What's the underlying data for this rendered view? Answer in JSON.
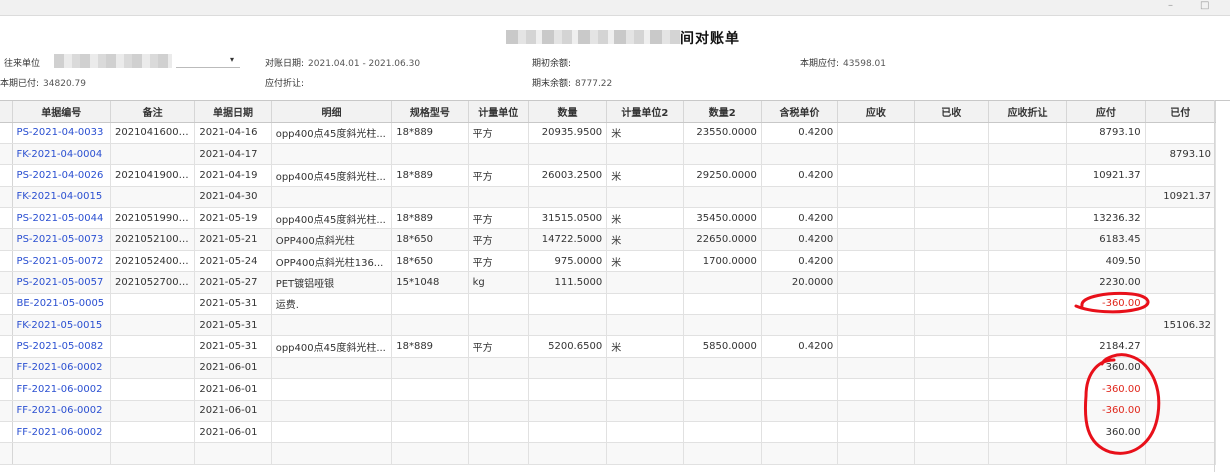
{
  "window": {
    "minimize": "–",
    "restore": "□"
  },
  "title": {
    "suffix": "间对账单"
  },
  "header": {
    "partner_label": "往来单位",
    "partner_value": "",
    "period_label": "对账日期:",
    "period_value": "2021.04.01 - 2021.06.30",
    "opening_label": "期初余额:",
    "opening_value": "",
    "payable_label": "本期应付:",
    "payable_value": "43598.01",
    "paid_label": "本期已付:",
    "paid_value": "34820.79",
    "discount_label": "应付折让:",
    "discount_value": "",
    "closing_label": "期末余额:",
    "closing_value": "8777.22"
  },
  "table": {
    "columns": [
      "单据编号",
      "备注",
      "单据日期",
      "明细",
      "规格型号",
      "计量单位",
      "数量",
      "计量单位2",
      "数量2",
      "含税单价",
      "应收",
      "已收",
      "应收折让",
      "应付",
      "已付"
    ],
    "rows": [
      {
        "no": "PS-2021-04-0033",
        "note": "20210416000...",
        "date": "2021-04-16",
        "detail": "opp400点45度斜光柱...",
        "spec": "18*889",
        "unit": "平方",
        "qty": "20935.9500",
        "unit2": "米",
        "qty2": "23550.0000",
        "price": "0.4200",
        "ar": "",
        "received": "",
        "ar_discount": "",
        "payable": "8793.10",
        "paid": ""
      },
      {
        "no": "FK-2021-04-0004",
        "note": "",
        "date": "2021-04-17",
        "detail": "",
        "spec": "",
        "unit": "",
        "qty": "",
        "unit2": "",
        "qty2": "",
        "price": "",
        "ar": "",
        "received": "",
        "ar_discount": "",
        "payable": "",
        "paid": "8793.10"
      },
      {
        "no": "PS-2021-04-0026",
        "note": "20210419000...",
        "date": "2021-04-19",
        "detail": "opp400点45度斜光柱...",
        "spec": "18*889",
        "unit": "平方",
        "qty": "26003.2500",
        "unit2": "米",
        "qty2": "29250.0000",
        "price": "0.4200",
        "ar": "",
        "received": "",
        "ar_discount": "",
        "payable": "10921.37",
        "paid": ""
      },
      {
        "no": "FK-2021-04-0015",
        "note": "",
        "date": "2021-04-30",
        "detail": "",
        "spec": "",
        "unit": "",
        "qty": "",
        "unit2": "",
        "qty2": "",
        "price": "",
        "ar": "",
        "received": "",
        "ar_discount": "",
        "payable": "",
        "paid": "10921.37"
      },
      {
        "no": "PS-2021-05-0044",
        "note": "20210519900...",
        "date": "2021-05-19",
        "detail": "opp400点45度斜光柱...",
        "spec": "18*889",
        "unit": "平方",
        "qty": "31515.0500",
        "unit2": "米",
        "qty2": "35450.0000",
        "price": "0.4200",
        "ar": "",
        "received": "",
        "ar_discount": "",
        "payable": "13236.32",
        "paid": ""
      },
      {
        "no": "PS-2021-05-0073",
        "note": "20210521000...",
        "date": "2021-05-21",
        "detail": "OPP400点斜光柱",
        "spec": "18*650",
        "unit": "平方",
        "qty": "14722.5000",
        "unit2": "米",
        "qty2": "22650.0000",
        "price": "0.4200",
        "ar": "",
        "received": "",
        "ar_discount": "",
        "payable": "6183.45",
        "paid": ""
      },
      {
        "no": "PS-2021-05-0072",
        "note": "20210524000...",
        "date": "2021-05-24",
        "detail": "OPP400点斜光柱136...",
        "spec": "18*650",
        "unit": "平方",
        "qty": "975.0000",
        "unit2": "米",
        "qty2": "1700.0000",
        "price": "0.4200",
        "ar": "",
        "received": "",
        "ar_discount": "",
        "payable": "409.50",
        "paid": ""
      },
      {
        "no": "PS-2021-05-0057",
        "note": "20210527000...",
        "date": "2021-05-27",
        "detail": "PET镀铝哑银",
        "spec": "15*1048",
        "unit": "kg",
        "qty": "111.5000",
        "unit2": "",
        "qty2": "",
        "price": "20.0000",
        "ar": "",
        "received": "",
        "ar_discount": "",
        "payable": "2230.00",
        "paid": ""
      },
      {
        "no": "BE-2021-05-0005",
        "note": "",
        "date": "2021-05-31",
        "detail": "运费.",
        "spec": "",
        "unit": "",
        "qty": "",
        "unit2": "",
        "qty2": "",
        "price": "",
        "ar": "",
        "received": "",
        "ar_discount": "",
        "payable": "-360.00",
        "paid": ""
      },
      {
        "no": "FK-2021-05-0015",
        "note": "",
        "date": "2021-05-31",
        "detail": "",
        "spec": "",
        "unit": "",
        "qty": "",
        "unit2": "",
        "qty2": "",
        "price": "",
        "ar": "",
        "received": "",
        "ar_discount": "",
        "payable": "",
        "paid": "15106.32"
      },
      {
        "no": "PS-2021-05-0082",
        "note": "",
        "date": "2021-05-31",
        "detail": "opp400点45度斜光柱...",
        "spec": "18*889",
        "unit": "平方",
        "qty": "5200.6500",
        "unit2": "米",
        "qty2": "5850.0000",
        "price": "0.4200",
        "ar": "",
        "received": "",
        "ar_discount": "",
        "payable": "2184.27",
        "paid": ""
      },
      {
        "no": "FF-2021-06-0002",
        "note": "",
        "date": "2021-06-01",
        "detail": "",
        "spec": "",
        "unit": "",
        "qty": "",
        "unit2": "",
        "qty2": "",
        "price": "",
        "ar": "",
        "received": "",
        "ar_discount": "",
        "payable": "360.00",
        "paid": ""
      },
      {
        "no": "FF-2021-06-0002",
        "note": "",
        "date": "2021-06-01",
        "detail": "",
        "spec": "",
        "unit": "",
        "qty": "",
        "unit2": "",
        "qty2": "",
        "price": "",
        "ar": "",
        "received": "",
        "ar_discount": "",
        "payable": "-360.00",
        "paid": ""
      },
      {
        "no": "FF-2021-06-0002",
        "note": "",
        "date": "2021-06-01",
        "detail": "",
        "spec": "",
        "unit": "",
        "qty": "",
        "unit2": "",
        "qty2": "",
        "price": "",
        "ar": "",
        "received": "",
        "ar_discount": "",
        "payable": "-360.00",
        "paid": ""
      },
      {
        "no": "FF-2021-06-0002",
        "note": "",
        "date": "2021-06-01",
        "detail": "",
        "spec": "",
        "unit": "",
        "qty": "",
        "unit2": "",
        "qty2": "",
        "price": "",
        "ar": "",
        "received": "",
        "ar_discount": "",
        "payable": "360.00",
        "paid": ""
      },
      {
        "no": "",
        "note": "",
        "date": "",
        "detail": "",
        "spec": "",
        "unit": "",
        "qty": "",
        "unit2": "",
        "qty2": "",
        "price": "",
        "ar": "",
        "received": "",
        "ar_discount": "",
        "payable": "",
        "paid": ""
      }
    ]
  },
  "colors": {
    "link": "#2a4fd1",
    "negative": "#e0261b",
    "annotation": "#e8101a"
  }
}
